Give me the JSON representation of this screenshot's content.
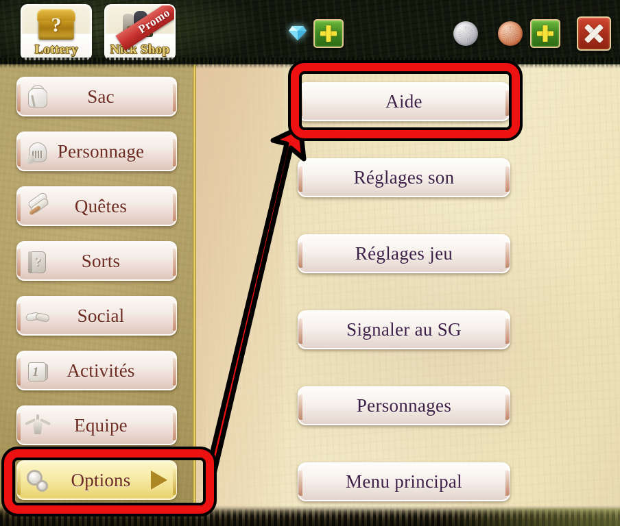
{
  "header": {
    "tiles": [
      {
        "label": "Lottery",
        "icon": "treasure-chest-icon",
        "badge": ""
      },
      {
        "label": "Nick Shop",
        "icon": "shop-figures-icon",
        "badge": "Promo"
      }
    ],
    "currency_icons": [
      {
        "name": "diamond-icon",
        "label": "diamond"
      },
      {
        "name": "add-diamond-button",
        "label": "+"
      },
      {
        "name": "silver-coin-icon",
        "label": "silver coin"
      },
      {
        "name": "copper-coin-icon",
        "label": "copper coin"
      },
      {
        "name": "add-coin-button",
        "label": "+"
      },
      {
        "name": "close-button",
        "label": "✕"
      }
    ]
  },
  "sidebar": {
    "items": [
      {
        "label": "Sac",
        "icon": "backpack-icon",
        "active": false
      },
      {
        "label": "Personnage",
        "icon": "helmet-icon",
        "active": false
      },
      {
        "label": "Quêtes",
        "icon": "scroll-icon",
        "active": false
      },
      {
        "label": "Sorts",
        "icon": "spellbook-icon",
        "active": false
      },
      {
        "label": "Social",
        "icon": "handshake-icon",
        "active": false
      },
      {
        "label": "Activités",
        "icon": "calendar-icon",
        "active": false
      },
      {
        "label": "Equipe",
        "icon": "emblem-icon",
        "active": false
      },
      {
        "label": "Options",
        "icon": "gears-icon",
        "active": true
      }
    ]
  },
  "main": {
    "buttons": [
      {
        "label": "Aide",
        "highlighted": true
      },
      {
        "label": "Réglages son",
        "highlighted": false
      },
      {
        "label": "Réglages jeu",
        "highlighted": false
      },
      {
        "label": "Signaler au SG",
        "highlighted": false
      },
      {
        "label": "Personnages",
        "highlighted": false
      },
      {
        "label": "Menu principal",
        "highlighted": false
      }
    ]
  },
  "annotation": {
    "color": "#ee1111",
    "outline_color": "#000000",
    "highlight_source": "Options",
    "highlight_target": "Aide",
    "arrow_description": "red arrow from Options sidebar button to Aide button"
  },
  "colors": {
    "accent_gold": "#e6d06a",
    "button_text": "#3d1f47",
    "sidebar_text": "#6d2a20",
    "parchment": "#ece0bd",
    "sidebar_bg": "#ab9a60",
    "header_bg": "#141a0e",
    "annotation_red": "#ee1111"
  }
}
